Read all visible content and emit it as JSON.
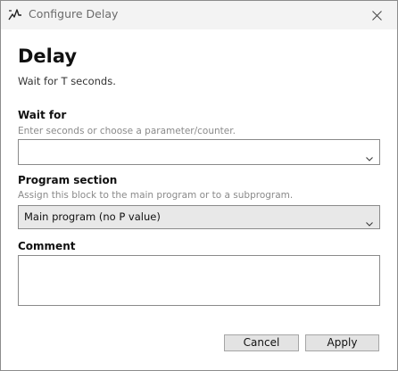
{
  "window": {
    "title": "Configure Delay"
  },
  "dialog": {
    "heading": "Delay",
    "subheading": "Wait for T seconds."
  },
  "wait_for": {
    "label": "Wait for",
    "help": "Enter seconds or choose a parameter/counter.",
    "value": ""
  },
  "program_section": {
    "label": "Program section",
    "help": "Assign this block to the main program or to a subprogram.",
    "selected": "Main program (no P value)"
  },
  "comment": {
    "label": "Comment",
    "value": ""
  },
  "buttons": {
    "cancel": "Cancel",
    "apply": "Apply"
  },
  "icons": {
    "app": "app-logo-icon",
    "close": "close-icon",
    "dropdown": "chevron-down-icon"
  }
}
